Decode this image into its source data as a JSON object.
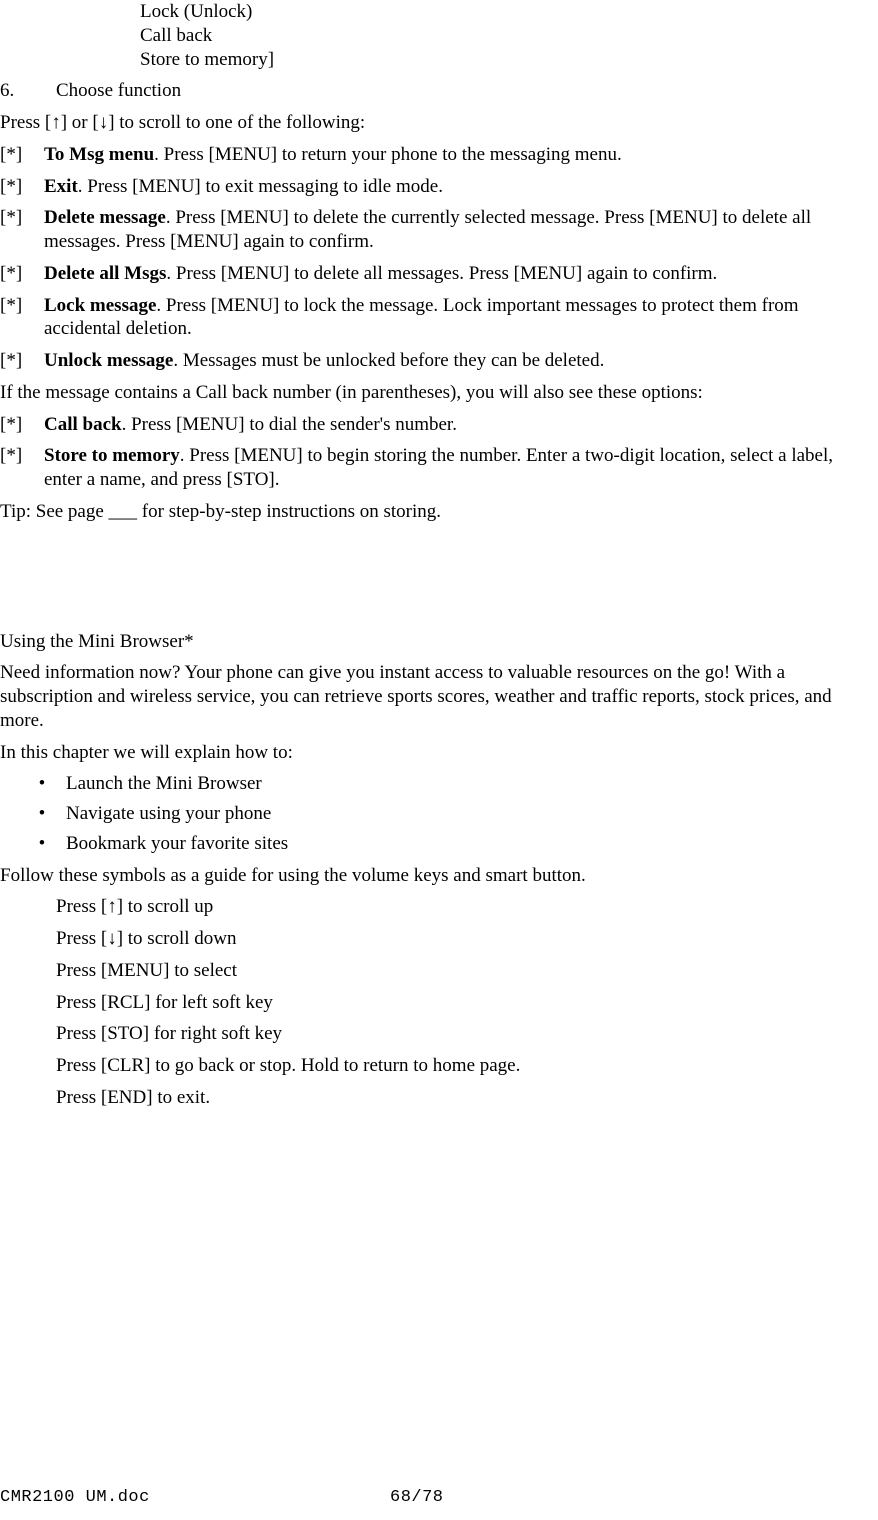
{
  "top_lines": [
    "Lock (Unlock)",
    "Call back",
    "Store to memory]"
  ],
  "step": {
    "num": "6.",
    "title": "Choose function",
    "intro_a": "Press [",
    "intro_b": "] or [",
    "intro_c": "] to scroll to one of the following:",
    "arrow_up": "↑",
    "arrow_down": "↓",
    "marker": "[*]",
    "options": [
      {
        "label": "To Msg menu",
        "text": ". Press [MENU] to return your phone to the messaging menu."
      },
      {
        "label": "Exit",
        "text": ". Press [MENU] to exit messaging to idle mode."
      },
      {
        "label": "Delete message",
        "text": ". Press [MENU] to delete the currently selected message. Press [MENU] to delete all messages. Press [MENU] again to confirm."
      },
      {
        "label": "Delete all Msgs",
        "text": ". Press [MENU] to delete all messages. Press [MENU] again to confirm."
      },
      {
        "label": "Lock message",
        "text": ". Press [MENU] to lock the message. Lock important messages to protect them from accidental deletion."
      },
      {
        "label": "Unlock message",
        "text": ". Messages must be unlocked before they can be deleted."
      }
    ],
    "callback_intro": "If the message contains a Call back number (in parentheses), you will also see these options:",
    "options2": [
      {
        "label": "Call back",
        "text": ". Press [MENU] to dial the sender's number."
      },
      {
        "label": "Store to memory",
        "text": ". Press [MENU] to begin storing the number. Enter a two-digit location, select a label, enter a name, and press [STO]."
      }
    ],
    "tip": "Tip:  See page ___ for step-by-step instructions on storing."
  },
  "browser": {
    "heading": "Using the Mini Browser*",
    "intro": "Need information now? Your phone can give you instant access to valuable resources on the go! With a subscription and wireless service, you can retrieve sports scores, weather and traffic reports, stock prices, and more.",
    "explain": "In this chapter we will explain how to:",
    "bullets": [
      "Launch the Mini Browser",
      "Navigate using your phone",
      "Bookmark your favorite sites"
    ],
    "bullet_sym": "•",
    "symbols_intro": "Follow these symbols as a guide for using the volume keys and smart button.",
    "sym_up_a": "Press [",
    "sym_up_b": "] to scroll up",
    "sym_dn_a": "Press [",
    "sym_dn_b": "] to scroll down",
    "sym_lines": [
      "Press [MENU] to select",
      "Press [RCL] for left soft key",
      "Press [STO] for right soft key",
      "Press [CLR] to go back or stop. Hold to return to home page.",
      "Press [END] to exit."
    ]
  },
  "footer": {
    "left": "CMR2100 UM.doc",
    "center": "68/78"
  }
}
